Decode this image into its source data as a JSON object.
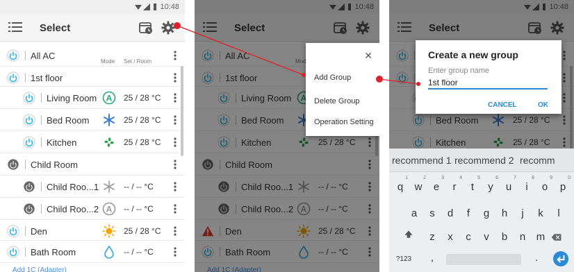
{
  "status": {
    "time": "10:48"
  },
  "appbar": {
    "title": "Select"
  },
  "header": {
    "mode": "Mode",
    "set_room": "Set / Room"
  },
  "rows": [
    {
      "name": "All AC",
      "temp": "",
      "mode": "none"
    },
    {
      "name": "1st floor",
      "temp": "",
      "mode": "none"
    },
    {
      "name": "Living Room",
      "temp": "25 / 28 °C",
      "mode": "auto"
    },
    {
      "name": "Bed Room",
      "temp": "25 / 28 °C",
      "mode": "cool"
    },
    {
      "name": "Kitchen",
      "temp": "25 / 28 °C",
      "mode": "fan"
    },
    {
      "name": "Child Room",
      "temp": "",
      "mode": "none"
    },
    {
      "name": "Child Roo...1",
      "temp": "-- / --   °C",
      "mode": "cool-gray"
    },
    {
      "name": "Child Roo...2",
      "temp": "-- / --   °C",
      "mode": "auto-gray"
    },
    {
      "name": "Den",
      "temp": "25 / 28 °C",
      "mode": "heat"
    },
    {
      "name": "Bath Room",
      "temp": "-- / --   °C",
      "mode": "dry"
    }
  ],
  "add_link": "Add 1C (Adapter)",
  "popup_menu": {
    "items": [
      "Add Group",
      "Delete Group",
      "Operation Setting"
    ]
  },
  "dialog": {
    "title": "Create a new group",
    "label": "Enter group name",
    "value": "1st floor",
    "cancel": "CANCEL",
    "ok": "OK"
  },
  "keyboard": {
    "suggestions": [
      "recommend 1",
      "recommend 2",
      "recomm"
    ],
    "row1": [
      "q",
      "w",
      "e",
      "r",
      "t",
      "y",
      "u",
      "i",
      "o",
      "p"
    ],
    "row1_hints": [
      "1",
      "2",
      "3",
      "4",
      "5",
      "6",
      "7",
      "8",
      "9",
      "0"
    ],
    "row2": [
      "a",
      "s",
      "d",
      "f",
      "g",
      "h",
      "j",
      "k",
      "l"
    ],
    "row3": [
      "z",
      "x",
      "c",
      "v",
      "b",
      "n",
      "m"
    ],
    "symbols": "?123",
    "comma": ",",
    "period": "."
  },
  "colors": {
    "accent": "#2b8ad6",
    "power_active": "#2bb5e8",
    "mode_auto": "#2aa87a",
    "mode_cool": "#3b7fd4",
    "mode_fan": "#2aa04a",
    "mode_heat": "#f6a300",
    "mode_dry": "#3aa8d8",
    "alert": "#e53935",
    "callout": "#e0202a"
  }
}
